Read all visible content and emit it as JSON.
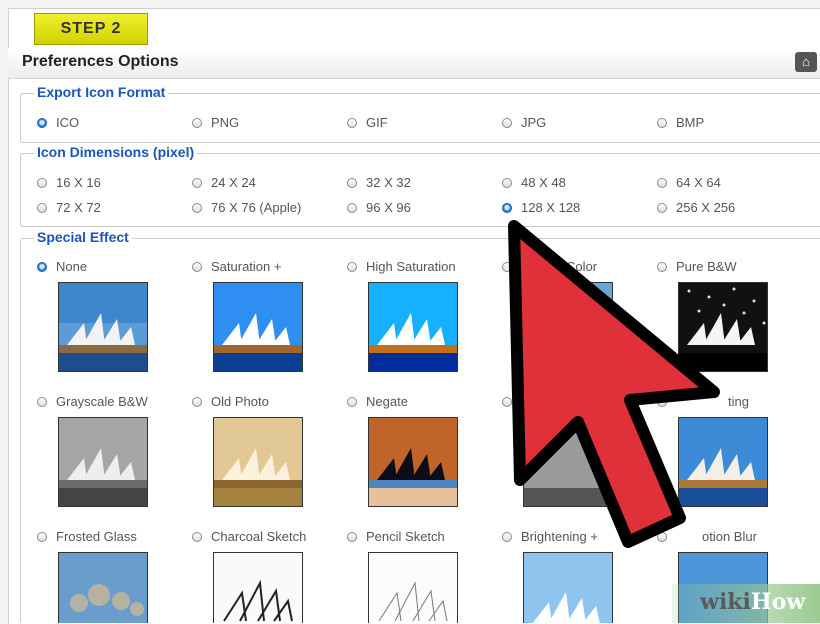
{
  "step_label": "STEP 2",
  "title": "Preferences Options",
  "home_icon": "home-icon",
  "export_format": {
    "legend": "Export Icon Format",
    "options": [
      "ICO",
      "PNG",
      "GIF",
      "JPG",
      "BMP"
    ],
    "selected": "ICO"
  },
  "dimensions": {
    "legend": "Icon Dimensions (pixel)",
    "row1": [
      "16 X 16",
      "24 X 24",
      "32 X 32",
      "48 X 48",
      "64 X 64"
    ],
    "row2": [
      "72 X 72",
      "76 X 76 (Apple)",
      "96 X 96",
      "128 X 128",
      "256 X 256"
    ],
    "selected": "128 X 128"
  },
  "effects": {
    "legend": "Special Effect",
    "row1": [
      "None",
      "Saturation +",
      "High Saturation",
      "Color",
      "Pure B&W"
    ],
    "row2": [
      "Grayscale B&W",
      "Old Photo",
      "Negate",
      "",
      "ting"
    ],
    "row3": [
      "Frosted Glass",
      "Charcoal Sketch",
      "Pencil Sketch",
      "Brightening +",
      "otion Blur"
    ],
    "selected": "None"
  },
  "watermark": {
    "part1": "wiki",
    "part2": "How"
  },
  "colors": {
    "step_bg": "#e2e21a",
    "legend": "#1a55b8",
    "arrow": "#e0303a"
  }
}
